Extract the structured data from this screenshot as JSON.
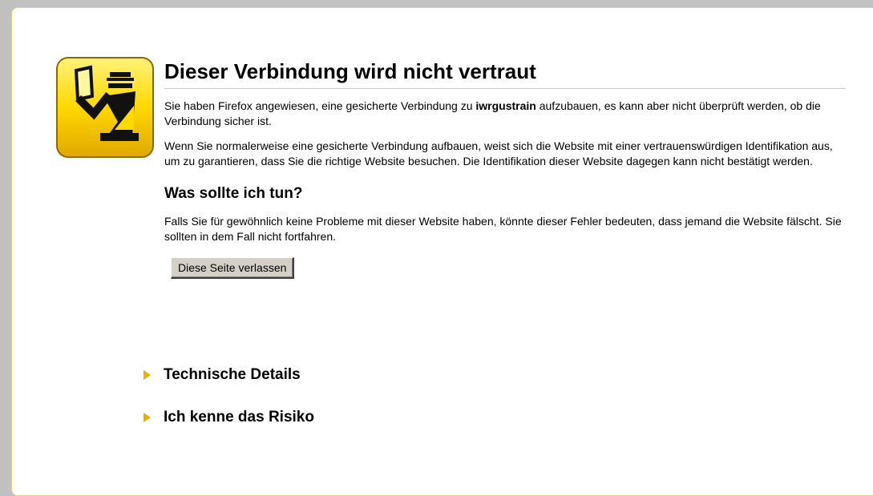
{
  "error": {
    "title": "Dieser Verbindung wird nicht vertraut",
    "para1_before": "Sie haben Firefox angewiesen, eine gesicherte Verbindung zu ",
    "para1_host": "iwrgustrain",
    "para1_after": " aufzubauen, es kann aber nicht überprüft werden, ob die Verbindung sicher ist.",
    "para2": "Wenn Sie normalerweise eine gesicherte Verbindung aufbauen, weist sich die Website mit einer vertrauenswürdigen Identifikation aus, um zu garantieren, dass Sie die richtige Website besuchen. Die Identifikation dieser Website dagegen kann nicht bestätigt werden.",
    "subtitle": "Was sollte ich tun?",
    "para3": "Falls Sie für gewöhnlich keine Probleme mit dieser Website haben, könnte dieser Fehler bedeuten, dass jemand die Website fälscht. Sie sollten in dem Fall nicht fortfahren.",
    "leave_button": "Diese Seite verlassen",
    "expander_technical": "Technische Details",
    "expander_risk": "Ich kenne das Risiko"
  },
  "icon": {
    "name": "security-officer-icon",
    "color": "#ffd700"
  }
}
